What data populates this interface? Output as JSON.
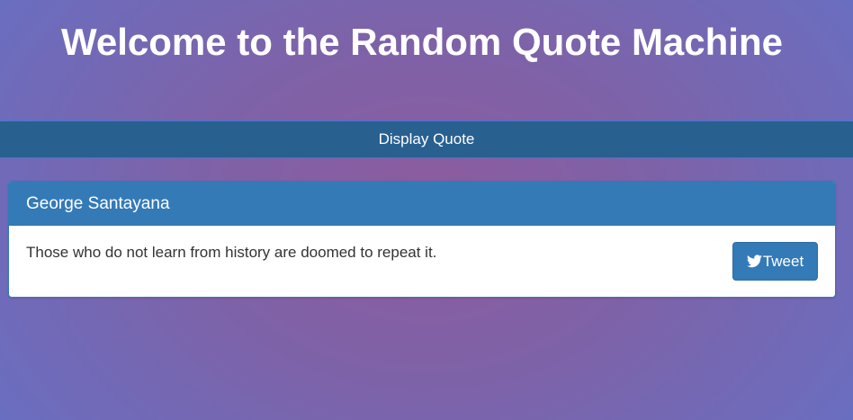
{
  "header": {
    "title": "Welcome to the Random Quote Machine"
  },
  "controls": {
    "display_label": "Display Quote"
  },
  "quote_panel": {
    "author": "George Santayana",
    "text": "Those who do not learn from history are doomed to repeat it.",
    "tweet_label": "Tweet",
    "tweet_icon": "twitter-bird-icon"
  },
  "colors": {
    "primary": "#337ab7",
    "primary_dark": "#286090",
    "background_center": "#8e5b9e",
    "background_edge": "#6a6ec0"
  }
}
